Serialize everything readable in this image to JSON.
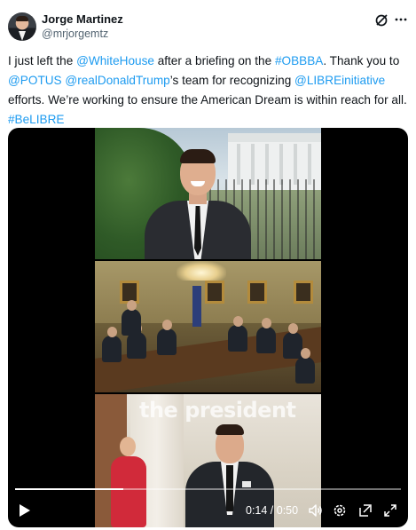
{
  "author": {
    "display_name": "Jorge Martinez",
    "handle": "@mrjorgemtz"
  },
  "header_icons": [
    "grok-icon",
    "more-icon"
  ],
  "tweet": {
    "segments": [
      {
        "text": "I just left the ",
        "link": false
      },
      {
        "text": "@WhiteHouse",
        "link": true
      },
      {
        "text": " after a briefing on the ",
        "link": false
      },
      {
        "text": "#OBBBA",
        "link": true
      },
      {
        "text": ". Thank you to ",
        "link": false
      },
      {
        "text": "@POTUS",
        "link": true
      },
      {
        "text": " ",
        "link": false
      },
      {
        "text": "@realDonaldTrump",
        "link": true
      },
      {
        "text": "’s team for recognizing ",
        "link": false
      },
      {
        "text": "@LIBREinitiative",
        "link": true
      },
      {
        "text": " efforts. We’re working to ensure the American Dream is within reach for all. ",
        "link": false
      },
      {
        "text": "#BeLIBRE",
        "link": true
      }
    ]
  },
  "video": {
    "caption_overlay": "the president",
    "current_time": "0:14",
    "duration": "0:50",
    "time_display": "0:14 / 0:50",
    "progress": 0.28,
    "controls": [
      "play-icon",
      "volume-icon",
      "settings-icon",
      "captions-icon",
      "fullscreen-icon"
    ]
  },
  "colors": {
    "link": "#1d9bf0",
    "text": "#0f1419",
    "secondary": "#536471"
  }
}
